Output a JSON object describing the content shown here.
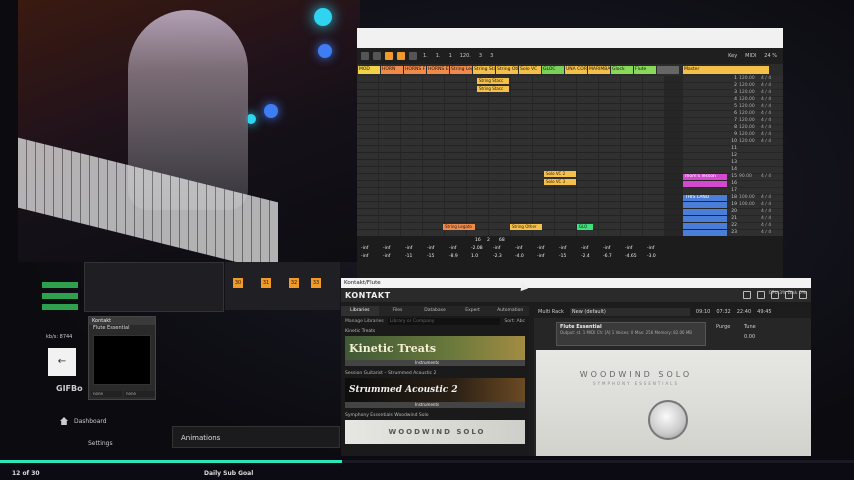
{
  "colors": {
    "orange": "#f09a2a",
    "pink": "#d34ad0",
    "green": "#2ea14e",
    "accent": "#2be6b8"
  },
  "ableton": {
    "transport": [
      "1.",
      "1.",
      "1",
      "120.",
      "3",
      "3",
      "Key",
      "MIDI",
      "24 %"
    ],
    "track_headers": [
      {
        "label": "MOD",
        "color": "#f2d24b"
      },
      {
        "label": "HORN",
        "color": "#f08a4a"
      },
      {
        "label": "HORNS F",
        "color": "#f08a4a"
      },
      {
        "label": "HORNS E",
        "color": "#f08a4a"
      },
      {
        "label": "String Legato",
        "color": "#f08a4a"
      },
      {
        "label": "String Stacc",
        "color": "#f5c04a"
      },
      {
        "label": "String Other",
        "color": "#f5c04a"
      },
      {
        "label": "Solo VC",
        "color": "#f5c04a"
      },
      {
        "label": "GLOC",
        "color": "#7ad158"
      },
      {
        "label": "UNA COR",
        "color": "#f5c04a"
      },
      {
        "label": "MARIMBA",
        "color": "#f5c04a"
      },
      {
        "label": "Glock",
        "color": "#8ad85a"
      },
      {
        "label": "Flute",
        "color": "#8ad85a"
      },
      {
        "label": "",
        "color": "#666"
      }
    ],
    "master_label": "Master",
    "clips": [
      {
        "label": "String Stacc",
        "color": "#f5c04a"
      },
      {
        "label": "String Stacc",
        "color": "#f5c04a"
      },
      {
        "label": "Solo VC 2",
        "color": "#f5c04a"
      },
      {
        "label": "Solo VC 3",
        "color": "#f5c04a"
      },
      {
        "label": "String Legato",
        "color": "#f08a4a"
      },
      {
        "label": "String Other",
        "color": "#f5c04a"
      },
      {
        "label": "GLO",
        "color": "#3ee07a"
      },
      {
        "label": "HO",
        "color": "#f09ad0"
      }
    ],
    "scenes": [
      {
        "num": "1",
        "bpm": "120.00",
        "sig": "4 / 4",
        "name": "",
        "style": ""
      },
      {
        "num": "2",
        "bpm": "120.00",
        "sig": "4 / 4",
        "name": "",
        "style": ""
      },
      {
        "num": "3",
        "bpm": "120.00",
        "sig": "4 / 4",
        "name": "",
        "style": ""
      },
      {
        "num": "4",
        "bpm": "120.00",
        "sig": "4 / 4",
        "name": "",
        "style": ""
      },
      {
        "num": "5",
        "bpm": "120.00",
        "sig": "4 / 4",
        "name": "",
        "style": ""
      },
      {
        "num": "6",
        "bpm": "120.00",
        "sig": "4 / 4",
        "name": "",
        "style": ""
      },
      {
        "num": "7",
        "bpm": "120.00",
        "sig": "4 / 4",
        "name": "",
        "style": ""
      },
      {
        "num": "8",
        "bpm": "120.00",
        "sig": "4 / 4",
        "name": "",
        "style": ""
      },
      {
        "num": "9",
        "bpm": "120.00",
        "sig": "4 / 4",
        "name": "",
        "style": ""
      },
      {
        "num": "10",
        "bpm": "120.00",
        "sig": "4 / 4",
        "name": "",
        "style": ""
      },
      {
        "num": "11",
        "bpm": "",
        "sig": "",
        "name": "",
        "style": ""
      },
      {
        "num": "12",
        "bpm": "",
        "sig": "",
        "name": "",
        "style": ""
      },
      {
        "num": "13",
        "bpm": "",
        "sig": "",
        "name": "",
        "style": ""
      },
      {
        "num": "14",
        "bpm": "",
        "sig": "",
        "name": "",
        "style": ""
      },
      {
        "num": "15",
        "bpm": "90.00",
        "sig": "4 / 4",
        "name": "mom's lesson",
        "style": "pink"
      },
      {
        "num": "16",
        "bpm": "",
        "sig": "",
        "name": "",
        "style": "pink"
      },
      {
        "num": "17",
        "bpm": "",
        "sig": "",
        "name": "",
        "style": ""
      },
      {
        "num": "18",
        "bpm": "100.00",
        "sig": "4 / 4",
        "name": "THIS LAND",
        "style": "blue"
      },
      {
        "num": "19",
        "bpm": "100.00",
        "sig": "4 / 4",
        "name": "",
        "style": "blue"
      },
      {
        "num": "20",
        "bpm": "",
        "sig": "4 / 4",
        "name": "",
        "style": "blue"
      },
      {
        "num": "21",
        "bpm": "",
        "sig": "4 / 4",
        "name": "",
        "style": "blue"
      },
      {
        "num": "22",
        "bpm": "",
        "sig": "4 / 4",
        "name": "",
        "style": "blue"
      },
      {
        "num": "23",
        "bpm": "",
        "sig": "4 / 4",
        "name": "",
        "style": "blue"
      },
      {
        "num": "24",
        "bpm": "",
        "sig": "4 / 4",
        "name": "",
        "style": ""
      },
      {
        "num": "25",
        "bpm": "",
        "sig": "4 / 4",
        "name": "",
        "style": ""
      },
      {
        "num": "26",
        "bpm": "",
        "sig": "4 / 4",
        "name": "",
        "style": ""
      }
    ],
    "mixer_values": [
      "-inf",
      "-inf",
      "-11",
      "-15",
      "-8.9",
      "1.0",
      "-2.3",
      "-4.0",
      "-inf",
      "-15",
      "-2.4",
      "-6.7",
      "-4.65",
      "-3.0"
    ],
    "mixer_top_values": [
      "-inf",
      "-inf",
      "-inf",
      "-inf",
      "-inf",
      "-2.08",
      "-inf",
      "-inf",
      "-inf",
      "-inf",
      "-inf",
      "-inf",
      "-inf",
      "-inf"
    ],
    "mixer_bottom": [
      "16",
      "2",
      "68"
    ]
  },
  "obs": {
    "numbers": [
      "30",
      "31",
      "32",
      "33"
    ],
    "panel_title": "Kontakt",
    "panel_item": "Flute Essential",
    "panel_foot": [
      "none",
      "none"
    ],
    "kbd_label": "kb/s: 8744",
    "gif_label": "GIFBo",
    "dashboard": "Dashboard",
    "settings": "Settings",
    "animations": "Animations"
  },
  "kontakt": {
    "window_title": "Kontakt/Flute",
    "logo": "KONTAKT",
    "tabs": [
      "Libraries",
      "Files",
      "Database",
      "Expert",
      "Automation"
    ],
    "manage": "Manage Libraries",
    "search_placeholder": "Library or Company",
    "sort": "Sort: Abc",
    "libraries": [
      {
        "name": "Kinetic Treats",
        "banner": "Kinetic Treats",
        "style": "kinetic"
      },
      {
        "name": "Session Guitarist – Strummed Acoustic 2",
        "banner": "Strummed Acoustic 2",
        "style": "acoustic"
      },
      {
        "name": "Symphony Essentials Woodwind Solo",
        "banner": "WOODWIND SOLO",
        "style": "woodwind"
      }
    ],
    "instruments_label": "Instruments",
    "multirack": "Multi Rack",
    "rack_name": "New (default)",
    "instrument_name": "Flute Essential",
    "instrument_sub": "Output: st. 1   MIDI Ch: [A] 1   Voices: 0   Max: 256   Memory: 82.06 MB",
    "purge": "Purge",
    "tune_label": "Tune",
    "tune_value": "0.00",
    "product": "WOODWIND SOLO",
    "product_sub": "SYMPHONY ESSENTIALS",
    "cpu": "CPU 3%  Disk 0%",
    "time_values": [
      "09:10",
      "07:32",
      "22:40",
      "49:45"
    ]
  },
  "stream": {
    "sub_count": "12 of 30",
    "goal_label": "Daily Sub Goal",
    "progress": 0.4
  }
}
